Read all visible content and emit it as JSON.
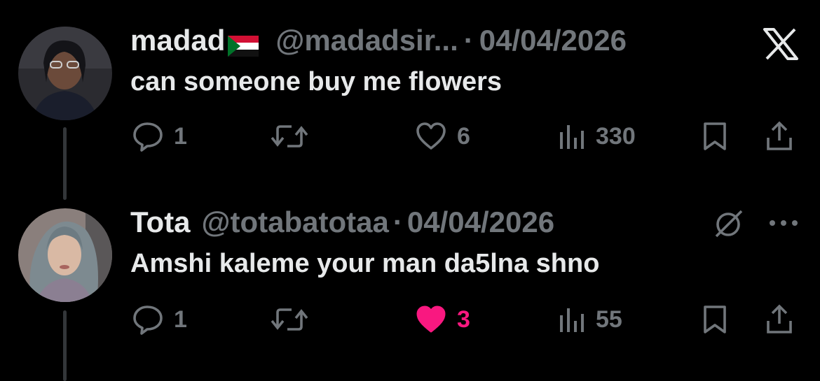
{
  "tweets": [
    {
      "name": "madad",
      "handle": "@madadsir...",
      "separator": "·",
      "date": "04/04/2026",
      "text": "can someone buy me flowers",
      "has_flag": true,
      "top_right_icon": "x-logo-icon",
      "actions": {
        "reply_count": "1",
        "retweet_count": "",
        "like_count": "6",
        "liked": false,
        "views_count": "330"
      }
    },
    {
      "name": "Tota",
      "handle": "@totabatotaa",
      "separator": "·",
      "date": "04/04/2026",
      "text": "Amshi kaleme your man da5lna shno",
      "has_flag": false,
      "top_right_icon": "grok-icon",
      "more_icon": "more-dots-icon",
      "actions": {
        "reply_count": "1",
        "retweet_count": "",
        "like_count": "3",
        "liked": true,
        "views_count": "55"
      }
    }
  ],
  "colors": {
    "background": "#000000",
    "text": "#e7e9ea",
    "muted": "#71767b",
    "like_active": "#f91880",
    "thread_line": "#333639"
  }
}
